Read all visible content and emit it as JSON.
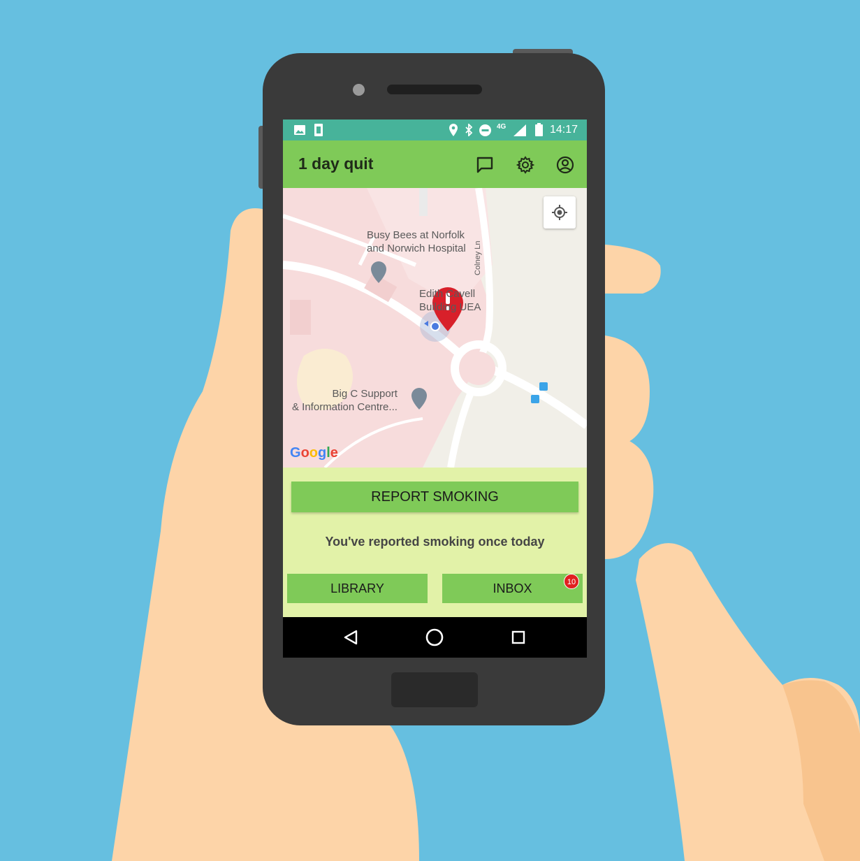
{
  "status_bar": {
    "time": "14:17",
    "network": "4G"
  },
  "app_bar": {
    "title": "1 day quit",
    "icons": [
      "chat-icon",
      "settings-gear-icon",
      "account-icon"
    ]
  },
  "map": {
    "labels": [
      {
        "line1": "Busy Bees at Norfolk",
        "line2": "and Norwich Hospital"
      },
      {
        "line1": "Edith Cavell",
        "line2": "Building UEA"
      },
      {
        "line1": "Big C Support",
        "line2": "& Information Centre..."
      },
      {
        "line1": "Colney Ln",
        "line2": ""
      }
    ],
    "google_logo": {
      "letters": [
        "G",
        "o",
        "o",
        "g",
        "l",
        "e"
      ],
      "colors": [
        "#4285F4",
        "#EA4335",
        "#FBBC05",
        "#4285F4",
        "#34A853",
        "#EA4335"
      ]
    },
    "marker_color": "#d8202a"
  },
  "actions": {
    "report_label": "REPORT SMOKING",
    "report_status": "You've reported smoking once today",
    "library_label": "LIBRARY",
    "inbox_label": "INBOX",
    "inbox_badge": "10"
  },
  "colors": {
    "accent_green": "#7fca58",
    "status_teal": "#47b39a",
    "panel_bg": "#e2f2a8",
    "badge_red": "#e02020"
  }
}
